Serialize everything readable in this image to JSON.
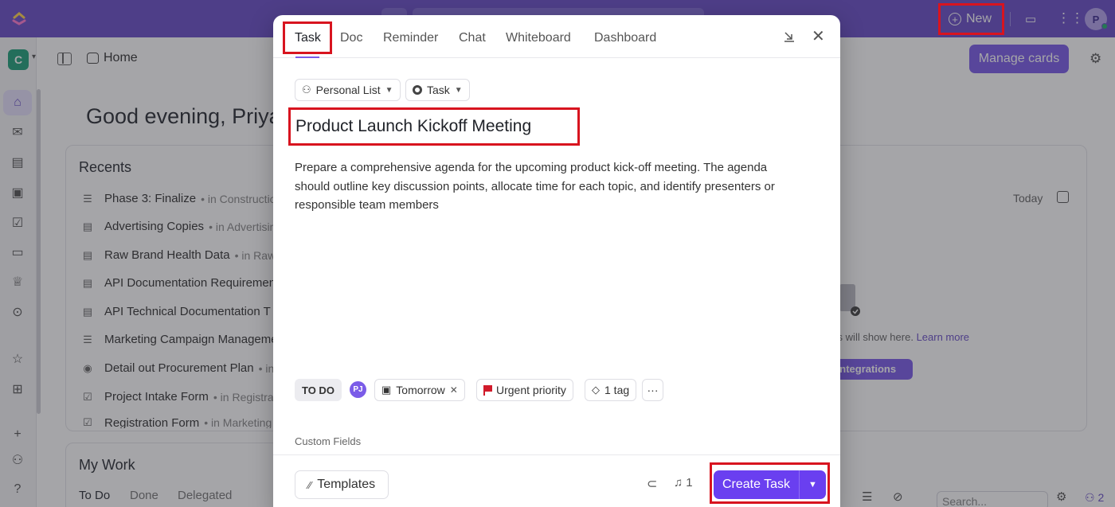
{
  "topbar": {
    "new_label": "New",
    "avatar_initial": "P"
  },
  "workspace": {
    "initial": "C"
  },
  "breadcrumb": {
    "home_label": "Home"
  },
  "home": {
    "manage_cards_label": "Manage cards",
    "greeting": "Good evening, Priya",
    "recents_title": "Recents",
    "recents": [
      {
        "name": "Phase 3: Finalize",
        "location": "• in Construction",
        "icon": "list-icon"
      },
      {
        "name": "Advertising Copies",
        "location": "• in Advertising",
        "icon": "doc-icon"
      },
      {
        "name": "Raw Brand Health Data",
        "location": "• in Raw",
        "icon": "doc-icon"
      },
      {
        "name": "API Documentation Requirements",
        "location": "",
        "icon": "doc-icon"
      },
      {
        "name": "API Technical Documentation T",
        "location": "",
        "icon": "doc-icon"
      },
      {
        "name": "Marketing Campaign Management",
        "location": "",
        "icon": "list-icon"
      },
      {
        "name": "Detail out Procurement Plan",
        "location": "• in",
        "icon": "task-icon"
      },
      {
        "name": "Project Intake Form",
        "location": "• in Registration",
        "icon": "form-icon"
      },
      {
        "name": "Registration Form",
        "location": "• in Marketing",
        "icon": "form-icon"
      }
    ],
    "mywork_title": "My Work",
    "mywork_tabs": [
      "To Do",
      "Done",
      "Delegated"
    ],
    "calendar": {
      "today_label": "Today",
      "empty_text": "ars will show here.",
      "learn_more": "Learn more",
      "integrations_button": "r integrations"
    },
    "bottom_search_placeholder": "Search...",
    "people_count": "2"
  },
  "modal": {
    "tabs": [
      "Task",
      "Doc",
      "Reminder",
      "Chat",
      "Whiteboard",
      "Dashboard"
    ],
    "active_tab": "Task",
    "location_label": "Personal List",
    "type_label": "Task",
    "task_title": "Product Launch Kickoff Meeting",
    "description": "Prepare a comprehensive agenda for the upcoming product kick-off meeting. The agenda should outline key discussion points, allocate time for each topic, and identify presenters or responsible team members",
    "status": "TO DO",
    "assignee_initials": "PJ",
    "due_date": "Tomorrow",
    "priority": "Urgent priority",
    "tags": "1 tag",
    "more": "···",
    "custom_fields_label": "Custom Fields",
    "templates_label": "Templates",
    "reminders_count": "1",
    "create_label": "Create Task"
  },
  "colors": {
    "brand": "#6a4fc8",
    "primary_button": "#6a3ff0",
    "highlight": "#d8141f",
    "urgent_flag": "#d11b2b"
  }
}
